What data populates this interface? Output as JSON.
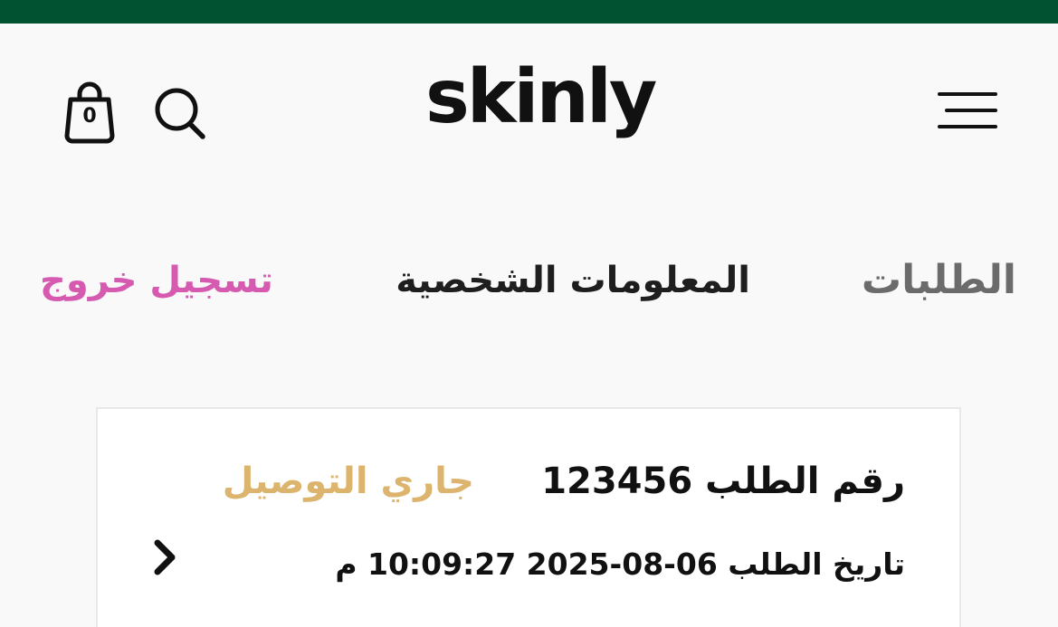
{
  "top_bar": {
    "text": "",
    "color": "#005230"
  },
  "header": {
    "logo_text": "skinly",
    "cart_count": "0",
    "icons": {
      "menu": "hamburger-menu-icon",
      "search": "search-icon",
      "cart": "shopping-bag-icon"
    }
  },
  "account_tabs": {
    "orders": "الطلبات",
    "profile": "المعلومات الشخصية",
    "logout": "تسجيل خروج",
    "colors": {
      "orders": "#6b6b6b",
      "profile": "#1e1e1e",
      "logout": "#d55ab0"
    }
  },
  "order_card": {
    "order_number": "رقم الطلب 123456",
    "status": "جاري التوصيل",
    "status_color": "#dcb46e",
    "date": "تاريخ الطلب 06-08-2025 10:09:27 م",
    "icon": "chevron-right-icon"
  }
}
